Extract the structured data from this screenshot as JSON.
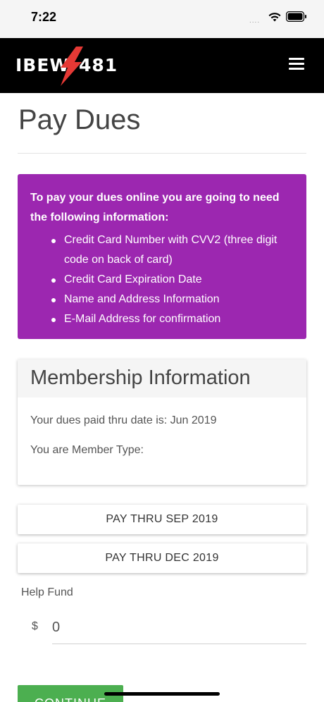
{
  "status_bar": {
    "time": "7:22",
    "signal": "....",
    "icons": [
      "wifi-icon",
      "battery-icon"
    ]
  },
  "header": {
    "logo_left": "IBEW",
    "logo_right": "481",
    "logo_icon": "lightning-bolt-icon",
    "menu_icon": "hamburger-menu-icon",
    "colors": {
      "background": "#000000",
      "bolt": "#e53935"
    }
  },
  "page": {
    "title": "Pay Dues"
  },
  "info_box": {
    "intro": "To pay your dues online you are going to need the following information:",
    "items": [
      "Credit Card Number with CVV2 (three digit code on back of card)",
      "Credit Card Expiration Date",
      "Name and Address Information",
      "E-Mail Address for confirmation"
    ],
    "background_color": "#9c27b0"
  },
  "membership": {
    "heading": "Membership Information",
    "paid_thru": "Your dues paid thru date is: Jun 2019",
    "member_type": "You are Member Type:"
  },
  "pay_options": [
    "PAY THRU SEP 2019",
    "PAY THRU DEC 2019"
  ],
  "help_fund": {
    "label": "Help Fund",
    "currency": "$",
    "value": "0"
  },
  "continue_label": "CONTINUE",
  "accent_color": "#4caf50"
}
